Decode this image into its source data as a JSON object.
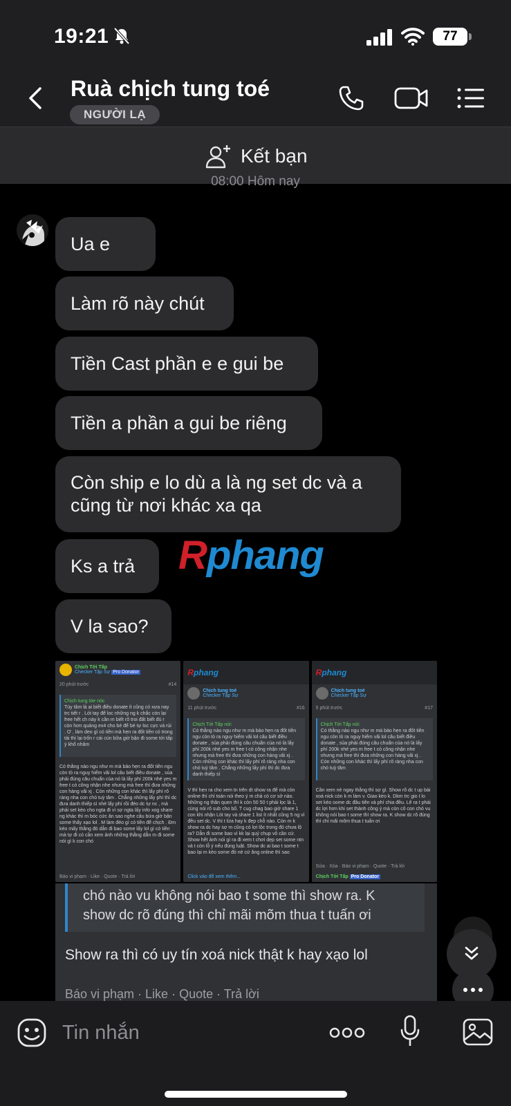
{
  "status_bar": {
    "time": "19:21",
    "battery": "77"
  },
  "header": {
    "contact_name": "Ruà chịch tung toé",
    "badge": "NGƯỜI LẠ"
  },
  "friend_bar": {
    "label": "Kết bạn"
  },
  "timestamp": "08:00 Hôm nay",
  "messages": [
    "Ua e",
    "Làm rõ này chút",
    "Tiền Cast phần e e gui be",
    "Tiền a phần a gui be riêng",
    "Còn ship e lo dù a là ng set dc và a cũng từ nơi khác xa qa",
    "Ks a trả",
    "V la sao?"
  ],
  "watermark": {
    "part1": "R",
    "part2": "phang"
  },
  "screenshot": {
    "shots": [
      {
        "user": "Chịch Tới Tấp",
        "role": "Checker Tập Sự",
        "badge": "Pro Donator",
        "time": "20 phút trước",
        "post_no": "#14",
        "quote_author": "Chịch tung tóe nóc",
        "quote_text": "Túy tâm là ai biết điều donate ít cũng có xưa nay trc tiết r . Lót tay để loc những ng k chắc còn lại free hết ch này k cần m biết rõ troi đất biết đủ r còn hơn quảng ex4 cho bé để bé tự loc cực và rủi . Ơ , làm deo gì có tiền mà hẹn ra đốt tiền có trong tài thì lại trốn r cái cún bữa giờ bận đi some tới tấp ý khổ nhâm",
        "body": "Có thằng nào ngu như m mà bảo hẹn ra đốt tiền ngu còn tỏ ra nguy hiểm vãi lol câu biết điều donate , sủa phải đúng câu chuẩn của nó là lấy phí 200k nhé yes m free t có công nhận nhe nhưng mà free thì đưa những con hàng vãi xj . Còn những con khác thì lấy phí rõ ràng nha con chó tuỳ tâm . Chẳng những lấy phí thì dc đưa danh thiếp sì nhè lấy phí rồi đéo dc tự nc , mà phải set kèo cho ngta đi vì sợ ngta lấy info xog share ng khác thì m bóc cức ăn sao nghe câu bừa giờ bận some thấy xạo lol . M làm đéo gì có tiền để chịch . Đm kéo mấy thằng đó dẫn đi bao some lấy lol gì có tiền mà tự đi có cần xem ảnh những thằng dẫn m đi some nói gì k con chó",
        "footer": "Báo vi phạm · Like · Quote · Trả lời"
      },
      {
        "user": "Chịch tung toé",
        "role": "Checker Tập Sự",
        "badge": "",
        "time": "11 phút trước",
        "post_no": "#16",
        "quote_author": "Chịch Tới Tấp nói:",
        "quote_text": "Có thằng nào ngu như m mà bảo hẹn ra đốt tiền ngu còn tỏ ra nguy hiểm vãi lol câu biết điều donate , sủa phải đúng câu chuẩn của nó là lấy phí 200k nhé yes m free t có công nhận nhe nhưng mà free thì đưa những con hàng vãi xj . Còn những con khác thì lấy phí rõ ràng nha con chó tuỳ tâm . Chẳng những lấy phí thì dc đưa danh thiếp sì",
        "body": "V thì hẹn ra cho xem tn trên dt show ra để mà còn online thì chỉ toàn nói theo ý m chả có cơ sở nào. Những ng thân quen thì k còn 50 50 t phải lọc là 1, cùng nói rõ sub cho bố. T cug chag bao giờ share 1 con khi nhận Lót tay và share 1 list ít nhất cũng 5 ng vì đều set dc. V thì t lừa hay k đẹp chỗ nào. Còn m k show ra dc hay sợ m cũng có lợi lộc trong đó chưa lộ ra? Dẫn đi some bao vì kk lại quý chụp vô cần cứ. Show hết ảnh nói gì ra đi xem t chơi dẹp set some ntn và t còn lỗ ý nếu đúng luật. Show dc ai bao t some t bao lại m kèo some đó nè cứ ăng online thì sao",
        "footer": "Click vào để xem thêm..."
      },
      {
        "user": "Chịch tung toé",
        "role": "Checker Tập Sự",
        "badge": "Pro Donator",
        "time": "5 phút trước",
        "post_no": "#17",
        "quote_author": "Chịch Tới Tấp nói:",
        "quote_text": "Có thằng nào ngu như m mà bảo hẹn ra đốt tiền ngu còn tỏ ra nguy hiểm vãi lol câu biết điều donate , sủa phải đúng câu chuẩn của nó là lấy phí 200k nhé yes m free t có công nhận nhe nhưng mà free thì đưa những con hàng vãi xj . Còn những con khác thì lấy phí rõ ràng nha con chó tuỳ tâm",
        "body": "Cần xem nè ngay thằng thì sợ gì. Show rõ dc t up bài xoá nick còn k m làm v. Giao kèo k. Dkm trc gio t lo set kèo some dc đầu tiên và phí chia đều. Lê ra t phải dc lợi hơn khi set thành công ý mà còn cô con chó vu không nói bao t some thì show ra. K show dc rõ đúng thì chỉ mãi mõm thua t tuấn ơi",
        "footer": "Sửa · Xóa · Báo vi phạm · Quote · Trả lời"
      }
    ],
    "zoom_quote": "chó nào vu không nói bao t some thì show ra. K show dc rõ đúng thì chỉ mãi mõm thua t tuấn ơi",
    "zoom_text": "Show ra thì có uy tín xoá nick thật k hay xạo lol",
    "zoom_footer": "Báo vi phạm · Like · Quote · Trả lời"
  },
  "composer": {
    "placeholder": "Tin nhắn"
  }
}
